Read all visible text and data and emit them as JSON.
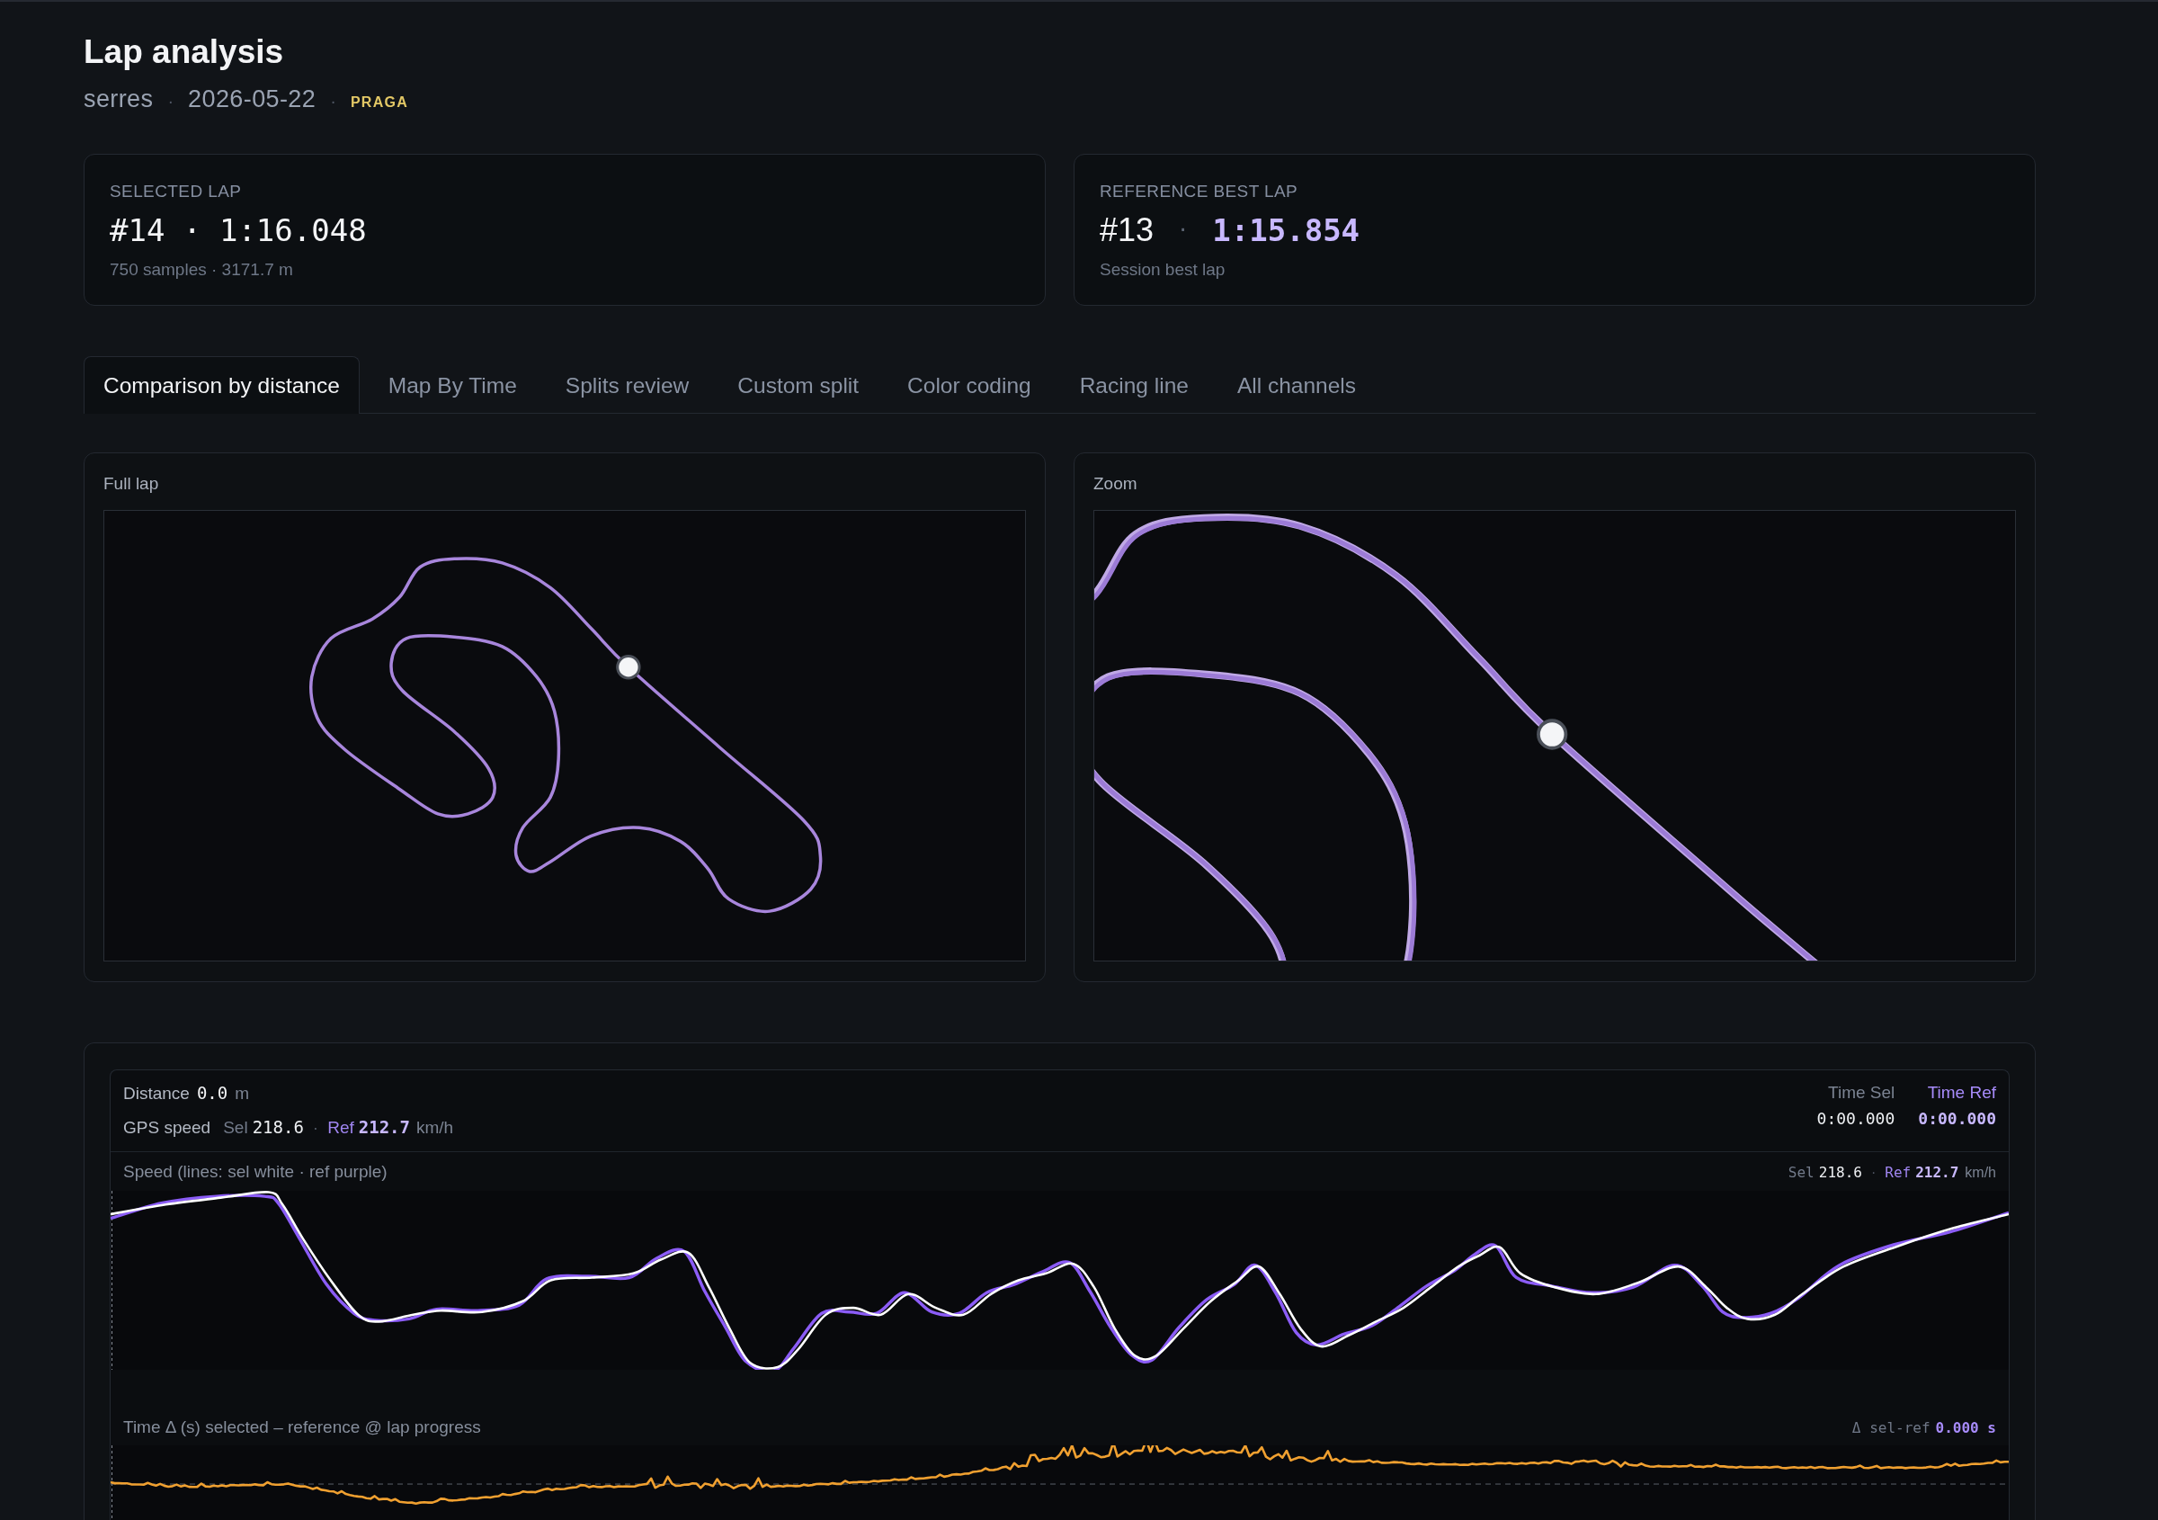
{
  "header": {
    "title": "Lap analysis",
    "meta": {
      "track": "serres",
      "date": "2026-05-22",
      "tag": "PRAGA",
      "separator": "·"
    }
  },
  "lap_cards": [
    {
      "kind": "selected",
      "label": "SELECTED LAP",
      "lap": "#14",
      "separator": "·",
      "time": "1:16.048",
      "detail": "750 samples · 3171.7 m"
    },
    {
      "kind": "reference",
      "label": "REFERENCE BEST LAP",
      "lap": "#13",
      "separator": "·",
      "time": "1:15.854",
      "detail": "Session best lap"
    }
  ],
  "tabs": [
    {
      "label": "Comparison by distance",
      "selected": true
    },
    {
      "label": "Map By Time",
      "selected": false
    },
    {
      "label": "Splits review",
      "selected": false
    },
    {
      "label": "Custom split",
      "selected": false
    },
    {
      "label": "Color coding",
      "selected": false
    },
    {
      "label": "Racing line",
      "selected": false
    },
    {
      "label": "All channels",
      "selected": false
    }
  ],
  "map_panels": [
    {
      "kind": "full",
      "title": "Full lap"
    },
    {
      "kind": "zoom",
      "title": "Zoom"
    }
  ],
  "telemetry": {
    "distance": {
      "label": "Distance",
      "value": "0.0",
      "unit": "m"
    },
    "gps_speed": {
      "label": "GPS speed",
      "readout": {
        "sel_label": "Sel",
        "sel_value": "218.6",
        "separator": "·",
        "ref_label": "Ref",
        "ref_value": "212.7",
        "unit": "km/h"
      }
    },
    "lap_times": [
      {
        "kind": "sel",
        "label": "Time Sel",
        "value": "0:00.000"
      },
      {
        "kind": "ref",
        "label": "Time Ref",
        "value": "0:00.000"
      }
    ],
    "speed_chart": {
      "title": "Speed (lines: sel white · ref purple)",
      "readout": {
        "sel_label": "Sel",
        "sel_value": "218.6",
        "separator": "·",
        "ref_label": "Ref",
        "ref_value": "212.7",
        "unit": "km/h"
      }
    },
    "delta_chart": {
      "title": "Time Δ (s) selected – reference @ lap progress",
      "readout_label": "Δ sel-ref",
      "readout_value": "0.000 s"
    }
  }
}
